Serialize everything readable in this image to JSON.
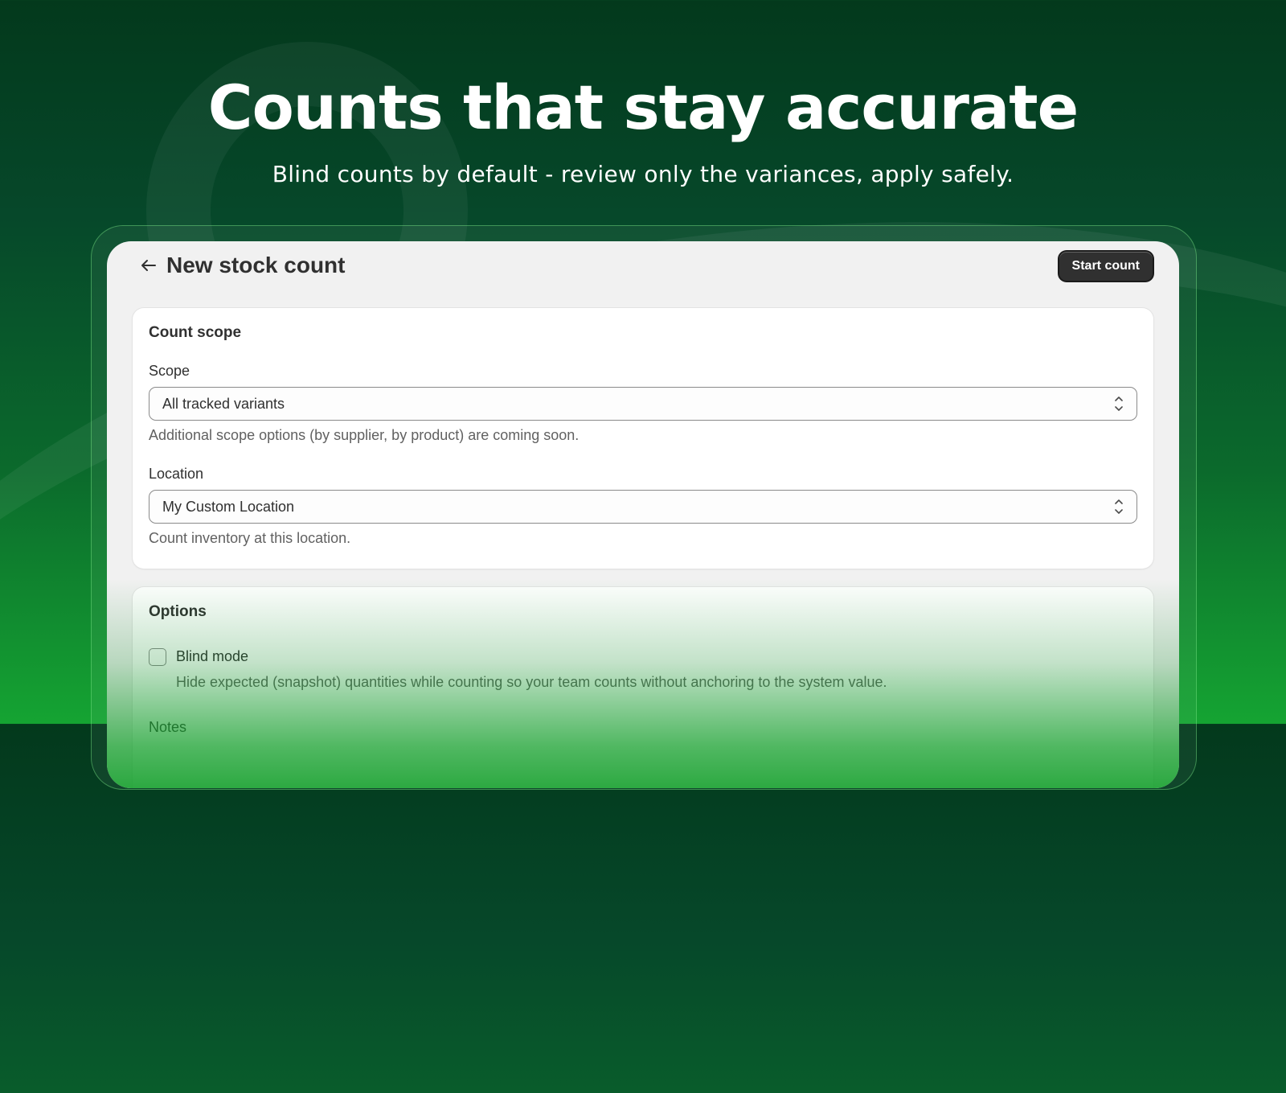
{
  "hero": {
    "title": "Counts that stay accurate",
    "subtitle": "Blind counts by default - review only the variances, apply safely."
  },
  "header": {
    "back_icon": "arrow-left-icon",
    "title": "New stock count",
    "start_label": "Start count"
  },
  "count_scope": {
    "title": "Count scope",
    "scope": {
      "label": "Scope",
      "value": "All tracked variants",
      "help": "Additional scope options (by supplier, by product) are coming soon."
    },
    "location": {
      "label": "Location",
      "value": "My Custom Location",
      "help": "Count inventory at this location."
    },
    "chevron_icon": "select-chevron-icon"
  },
  "options": {
    "title": "Options",
    "blind_mode": {
      "label": "Blind mode",
      "checked": false,
      "help": "Hide expected (snapshot) quantities while counting so your team counts without anchoring to the system value."
    },
    "notes_label": "Notes"
  },
  "colors": {
    "primary_button": "#303030",
    "background_top": "#03391c",
    "background_bottom": "#15a432"
  }
}
